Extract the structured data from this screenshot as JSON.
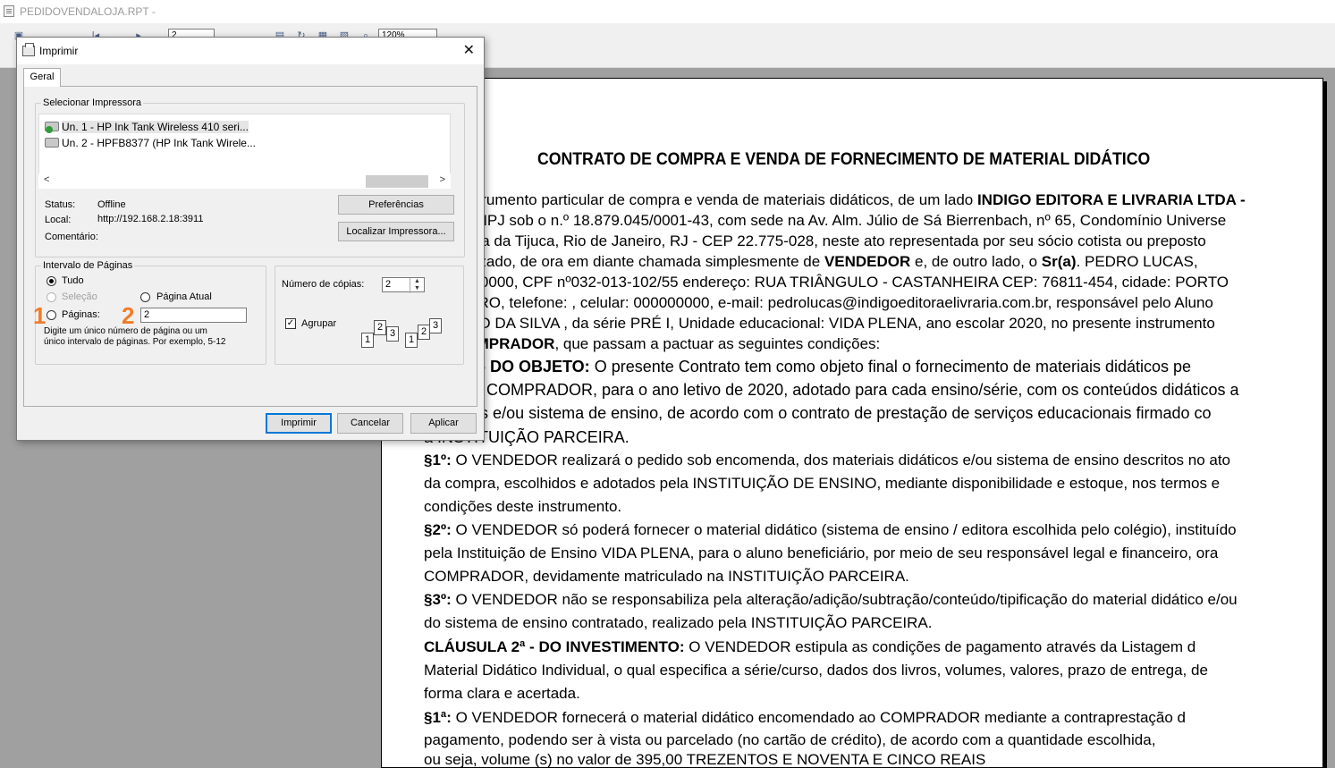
{
  "app": {
    "title": "PEDIDOVENDALOJA.RPT -",
    "toolbar": {
      "page_field": "2",
      "zoom": "120%"
    }
  },
  "report": {
    "title": "CONTRATO DE COMPRA E VENDA DE FORNECIMENTO DE MATERIAL DIDÁTICO",
    "lines": [
      [
        "ente instrumento particular de compra e venda de materiais didáticos, de um lado ",
        "INDIGO EDITORA E LIVRARIA LTDA -",
        ""
      ],
      [
        "ita no CNPJ sob o n.º 18.879.045/0001-43, com sede na Av. Alm. Júlio de Sá Bierrenbach, nº 65, Condomínio Universe",
        "",
        ""
      ],
      [
        "rial, Barra da Tijuca, Rio de Janeiro, RJ - CEP 22.775-028, neste ato representada por seu sócio cotista ou preposto",
        "",
        ""
      ],
      [
        "te autorizado, de ora em diante chamada simplesmente de ",
        "VENDEDOR",
        " e, de outro lado, o "
      ],
      [
        "e nº 0000000, CPF nº032-013-102/55 endereço: RUA TRIÂNGULO - CASTANHEIRA CEP: 76811-454, cidade: PORTO",
        "",
        ""
      ],
      [
        "estado: RO, telefone: , celular: 000000000, e-mail: pedrolucas@indigoeditoraelivraria.com.br, responsável pelo Aluno",
        "",
        ""
      ],
      [
        "rio: JOÃO DA SILVA , da série PRÉ I, Unidade educacional: VIDA PLENA, ano escolar 2020, no presente instrumento",
        "",
        ""
      ],
      [
        "ado ",
        "COMPRADOR",
        ", que passam a pactuar as seguintes condições:"
      ],
      [
        "ULA 1ª - DO OBJETO:",
        "",
        " O presente Contrato tem como objeto final o fornecimento de materiais didáticos pe"
      ],
      [
        "DOR ao COMPRADOR, para o ano letivo de 2020, adotado para cada ensino/série, com os conteúdos didáticos a",
        "",
        ""
      ],
      [
        "cionados e/ou sistema de ensino, de acordo com o contrato de prestação de serviços educacionais firmado co",
        "",
        ""
      ],
      [
        "a INSTITUIÇÃO PARCEIRA.",
        "",
        ""
      ],
      [
        "§1º:",
        "",
        " O VENDEDOR realizará o pedido sob encomenda, dos materiais didáticos e/ou sistema de ensino descritos no ato"
      ],
      [
        "da compra, escolhidos e adotados pela INSTITUIÇÃO DE ENSINO, mediante disponibilidade e estoque, nos termos e",
        "",
        ""
      ],
      [
        "condições deste instrumento.",
        "",
        ""
      ],
      [
        "§2º:",
        "",
        " O VENDEDOR só poderá fornecer o material didático (sistema de ensino / editora escolhida pelo colégio), instituído"
      ],
      [
        "pela Instituição de Ensino VIDA PLENA, para o aluno beneficiário, por meio de seu responsável legal e financeiro, ora",
        "",
        ""
      ],
      [
        "COMPRADOR, devidamente matriculado na INSTITUIÇÃO PARCEIRA.",
        "",
        ""
      ],
      [
        "§3º:",
        "",
        " O VENDEDOR não se responsabiliza pela alteração/adição/subtração/conteúdo/tipificação do material didático e/ou"
      ],
      [
        "do sistema de ensino contratado, realizado pela INSTITUIÇÃO PARCEIRA.",
        "",
        ""
      ],
      [
        "CLÁUSULA 2ª - DO INVESTIMENTO:",
        "",
        " O VENDEDOR estipula as condições de pagamento através da Listagem d"
      ],
      [
        "Material Didático Individual, o qual especifica a série/curso, dados dos livros, volumes, valores, prazo de entrega, de",
        "",
        ""
      ],
      [
        "forma clara e acertada.",
        "",
        ""
      ],
      [
        "§1ª:",
        "",
        " O VENDEDOR fornecerá o material didático encomendado ao COMPRADOR mediante a contraprestação d"
      ],
      [
        "pagamento, podendo ser à vista ou parcelado (no cartão de crédito), de acordo com a quantidade escolhida,",
        "",
        ""
      ],
      [
        "ou seja,         volume (s) no valor de 395,00 TREZENTOS E NOVENTA E CINCO REAIS",
        "",
        ""
      ]
    ],
    "line4_tail_bold": "Sr(a)",
    "line4_tail": ". PEDRO LUCAS,"
  },
  "dialog": {
    "title": "Imprimir",
    "tab": "Geral",
    "select_printer_group": "Selecionar Impressora",
    "printers": [
      "Un. 1 - HP Ink Tank Wireless 410 seri...",
      "Un. 2 - HPFB8377 (HP Ink Tank Wirele..."
    ],
    "status_label": "Status:",
    "status_value": "Offline",
    "location_label": "Local:",
    "location_value": "http://192.168.2.18:3911",
    "comment_label": "Comentário:",
    "preferences_button": "Preferências",
    "find_printer_button": "Localizar Impressora...",
    "page_range_group": "Intervalo de Páginas",
    "range_all": "Tudo",
    "range_selection": "Seleção",
    "range_current": "Página Atual",
    "range_pages": "Páginas:",
    "pages_value": "2",
    "pages_hint": "Digite um único número de página ou um único intervalo de páginas. Por exemplo, 5-12",
    "copies_label": "Número de cópias:",
    "copies_value": "2",
    "collate_label": "Agrupar",
    "print_button": "Imprimir",
    "cancel_button": "Cancelar",
    "apply_button": "Aplicar",
    "selected_range": "pages"
  },
  "annotations": {
    "marker1": "1",
    "marker2": "2",
    "color": "#f07c2a"
  }
}
